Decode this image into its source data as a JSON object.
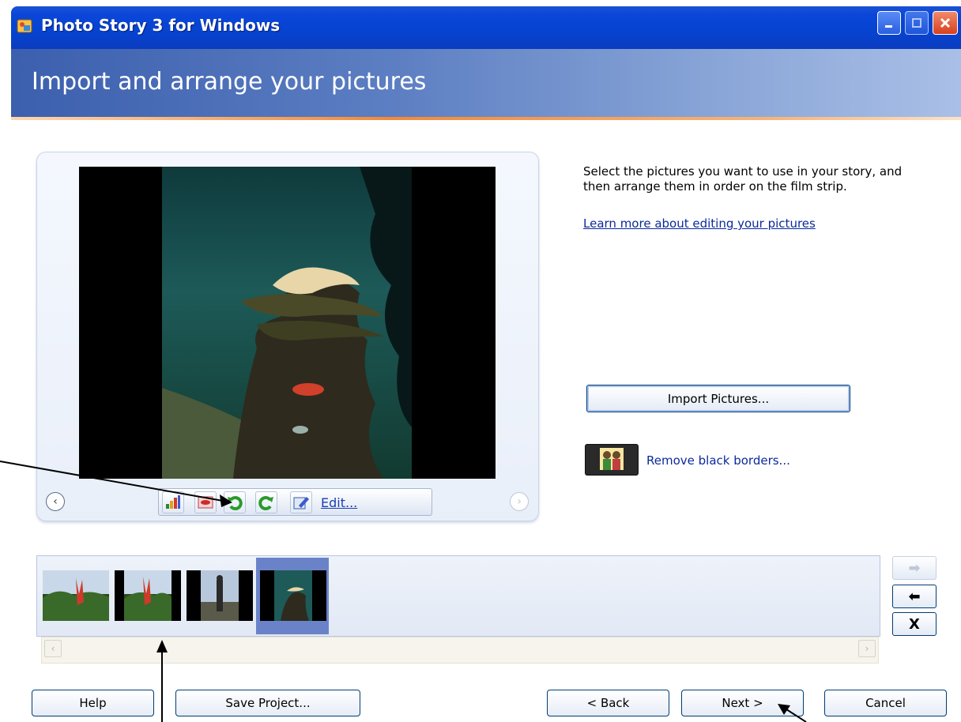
{
  "window": {
    "title": "Photo Story 3 for Windows",
    "icon": "photo-story-app-icon"
  },
  "header": {
    "title": "Import and arrange your pictures"
  },
  "instructions": {
    "text": "Select the pictures you want to use in your story, and then arrange them in order on the film strip.",
    "learn_link": "Learn more about editing your pictures"
  },
  "preview": {
    "tools": [
      {
        "icon": "auto-correct-color-icon"
      },
      {
        "icon": "red-eye-icon"
      },
      {
        "icon": "rotate-left-icon"
      },
      {
        "icon": "rotate-right-icon"
      }
    ],
    "edit_label": "Edit..."
  },
  "actions": {
    "import_label": "Import Pictures...",
    "remove_borders_label": "Remove black borders..."
  },
  "filmstrip": {
    "thumbnails": [
      {
        "name": "garden-trees"
      },
      {
        "name": "garden-trees-bordered"
      },
      {
        "name": "figure-statue"
      },
      {
        "name": "underwater-reef",
        "selected": true
      }
    ],
    "side_buttons": {
      "move_right": "➡",
      "move_left": "⬅",
      "delete": "X"
    }
  },
  "footer": {
    "help": "Help",
    "save": "Save Project...",
    "back": "< Back",
    "next": "Next >",
    "cancel": "Cancel"
  }
}
